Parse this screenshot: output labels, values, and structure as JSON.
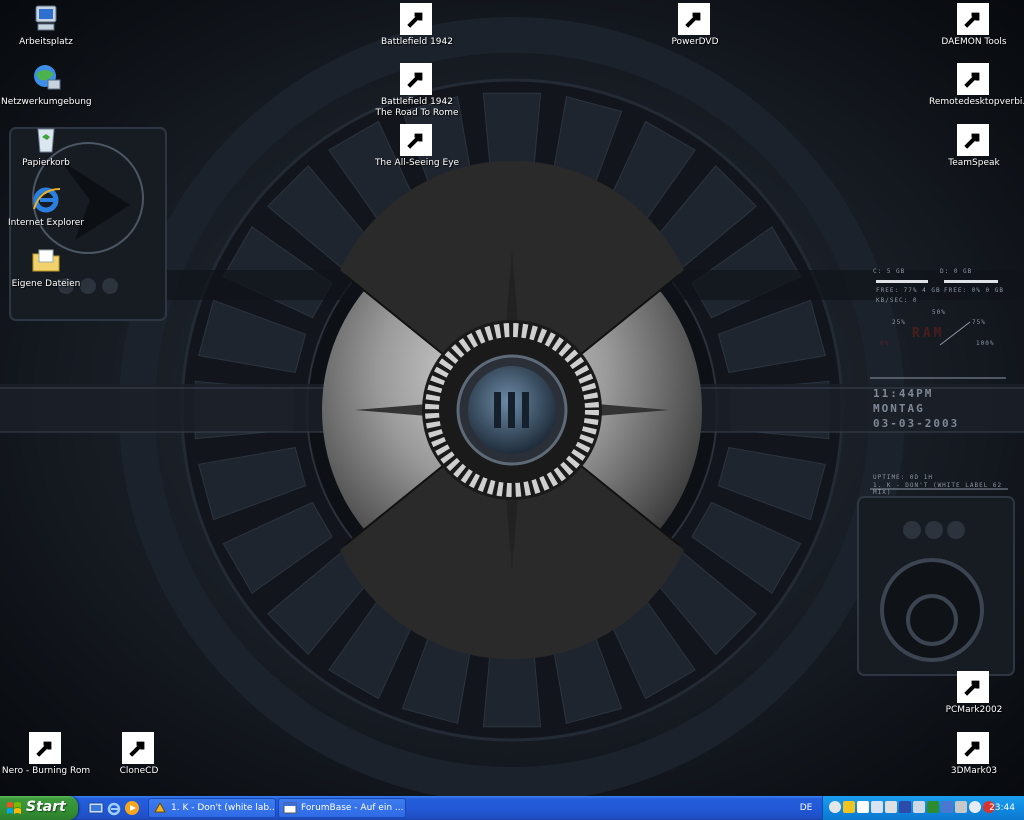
{
  "desktop": {
    "icons": [
      {
        "label": "Arbeitsplatz",
        "icon": "my-computer-icon"
      },
      {
        "label": "Netzwerkumgebung",
        "icon": "network-places-icon"
      },
      {
        "label": "Papierkorb",
        "icon": "recycle-bin-icon"
      },
      {
        "label": "Internet Explorer",
        "icon": "internet-explorer-icon"
      },
      {
        "label": "Eigene Dateien",
        "icon": "my-documents-icon"
      },
      {
        "label": "Battlefield 1942",
        "icon": "battlefield-icon"
      },
      {
        "label": "Battlefield 1942 The Road To Rome",
        "icon": "battlefield-rtr-icon"
      },
      {
        "label": "The All-Seeing Eye",
        "icon": "all-seeing-eye-icon"
      },
      {
        "label": "PowerDVD",
        "icon": "powerdvd-icon"
      },
      {
        "label": "DAEMON Tools",
        "icon": "daemon-tools-icon"
      },
      {
        "label": "Remotedesktopverbi...",
        "icon": "remote-desktop-icon"
      },
      {
        "label": "TeamSpeak",
        "icon": "teamspeak-icon"
      },
      {
        "label": "PCMark2002",
        "icon": "pcmark-icon"
      },
      {
        "label": "3DMark03",
        "icon": "3dmark-icon"
      },
      {
        "label": "Nero - Burning Rom",
        "icon": "nero-icon"
      },
      {
        "label": "CloneCD",
        "icon": "clonecd-icon"
      }
    ]
  },
  "wallpaper_hud": {
    "drive_c": "C: 5 GB",
    "drive_d": "D: 0 GB",
    "free_c": "FREE: 77% 4 GB",
    "free_d": "FREE: 0% 0 GB",
    "kbsec": "KB/SEC: 0",
    "p50": "50%",
    "p25": "25%",
    "p75": "75%",
    "p0": "0%",
    "p100": "100%",
    "ram": "RAM",
    "time": "11:44PM",
    "day": "MONTAG",
    "date": "03-03-2003",
    "uptime": "UPTIME: 0D 1H",
    "now_playing": "1. K - DON'T (WHITE LABEL 62 MIX)"
  },
  "taskbar": {
    "start_label": "Start",
    "quick_launch": [
      "show-desktop-icon",
      "ie-quicklaunch-icon",
      "media-player-icon"
    ],
    "buttons": [
      {
        "label": "1. K - Don't (white lab...",
        "icon": "winamp-icon"
      },
      {
        "label": "ForumBase - Auf ein ...",
        "icon": "browser-window-icon"
      }
    ],
    "language": "DE",
    "clock": "23:44"
  },
  "colors": {
    "taskbar_blue": "#245edb",
    "start_green": "#3c9a3c",
    "tray_blue": "#0f8ae0"
  }
}
